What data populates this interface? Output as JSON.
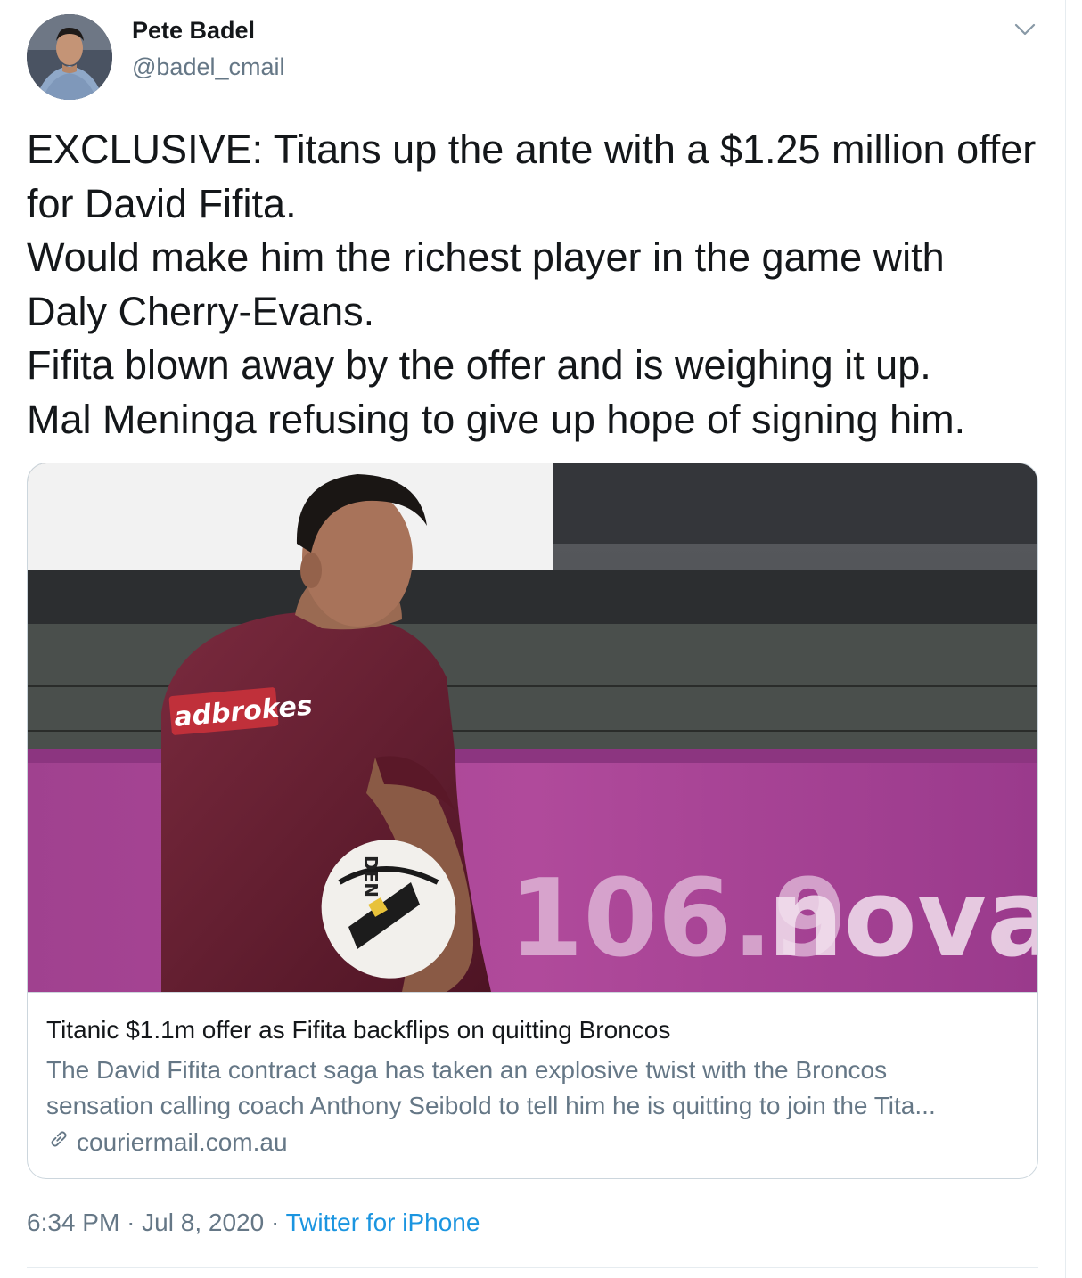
{
  "tweet": {
    "author": {
      "name": "Pete Badel",
      "handle": "@badel_cmail"
    },
    "text_lines": [
      "EXCLUSIVE: Titans up the ante with a $1.25 million offer",
      "for David Fifita.",
      "Would make him the richest player in the game with",
      "Daly Cherry-Evans.",
      "Fifita blown away by the offer and is weighing it up.",
      "Mal Meninga refusing to give up hope of signing him."
    ],
    "card": {
      "title": "Titanic $1.1m offer as Fifita backflips on quitting Broncos",
      "description_lines": [
        "The David Fifita contract saga has taken an explosive twist with the Broncos",
        "sensation calling coach Anthony Seibold to tell him he is quitting to join the Tita..."
      ],
      "domain": "couriermail.com.au",
      "image_signage": {
        "sponsor": "adbrokes",
        "radio": "106.9",
        "brand": "nova",
        "ball_text": "DEN"
      }
    },
    "meta": {
      "time": "6:34 PM",
      "separator": "·",
      "date": "Jul 8, 2020",
      "source": "Twitter for iPhone"
    }
  },
  "colors": {
    "text": "#14171a",
    "secondary": "#657786",
    "link": "#1b95e0",
    "border": "#ccd6dd",
    "jersey": "#6b1f33",
    "signage": "#9c3c8f"
  },
  "icons": [
    "caret-down-icon",
    "link-icon"
  ]
}
